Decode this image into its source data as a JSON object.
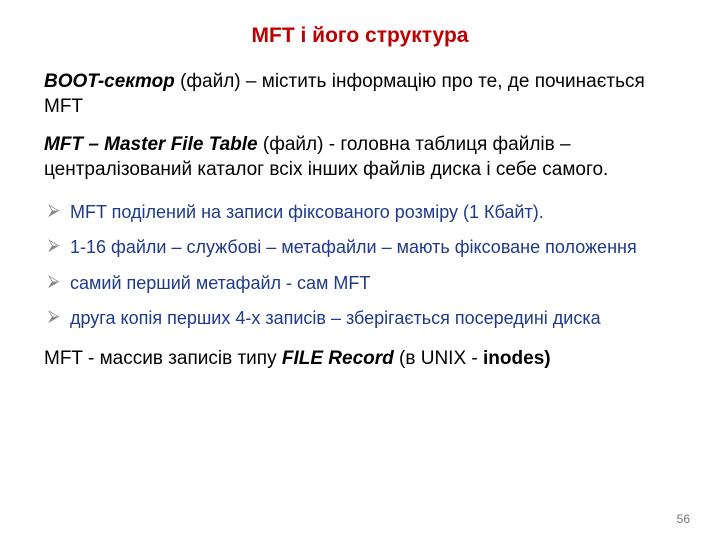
{
  "title": "MFT  і  його структура",
  "paragraphs": {
    "p1": {
      "lead": "BOOT-сектор",
      "rest": " (файл) – містить інформацію про те, де починається MFT"
    },
    "p2": {
      "lead": "MFT – Master File Table",
      "rest": " (файл) - головна таблиця файлів – централізований каталог всіх інших файлів диска і себе самого."
    }
  },
  "bullets": [
    "MFT поділений на записи фіксованого розміру (1 Кбайт).",
    "1-16 файли – службові – метафайли – мають фіксоване положення",
    "самий перший метафайл - сам MFT",
    "друга копія перших 4-х записів – зберігається посередині диска"
  ],
  "footer": {
    "prefix": "MFT  -  массив записів типу ",
    "em1": "FILE Record",
    "mid": " (в UNIX - ",
    "em2": "inodes)"
  },
  "page_number": "56"
}
